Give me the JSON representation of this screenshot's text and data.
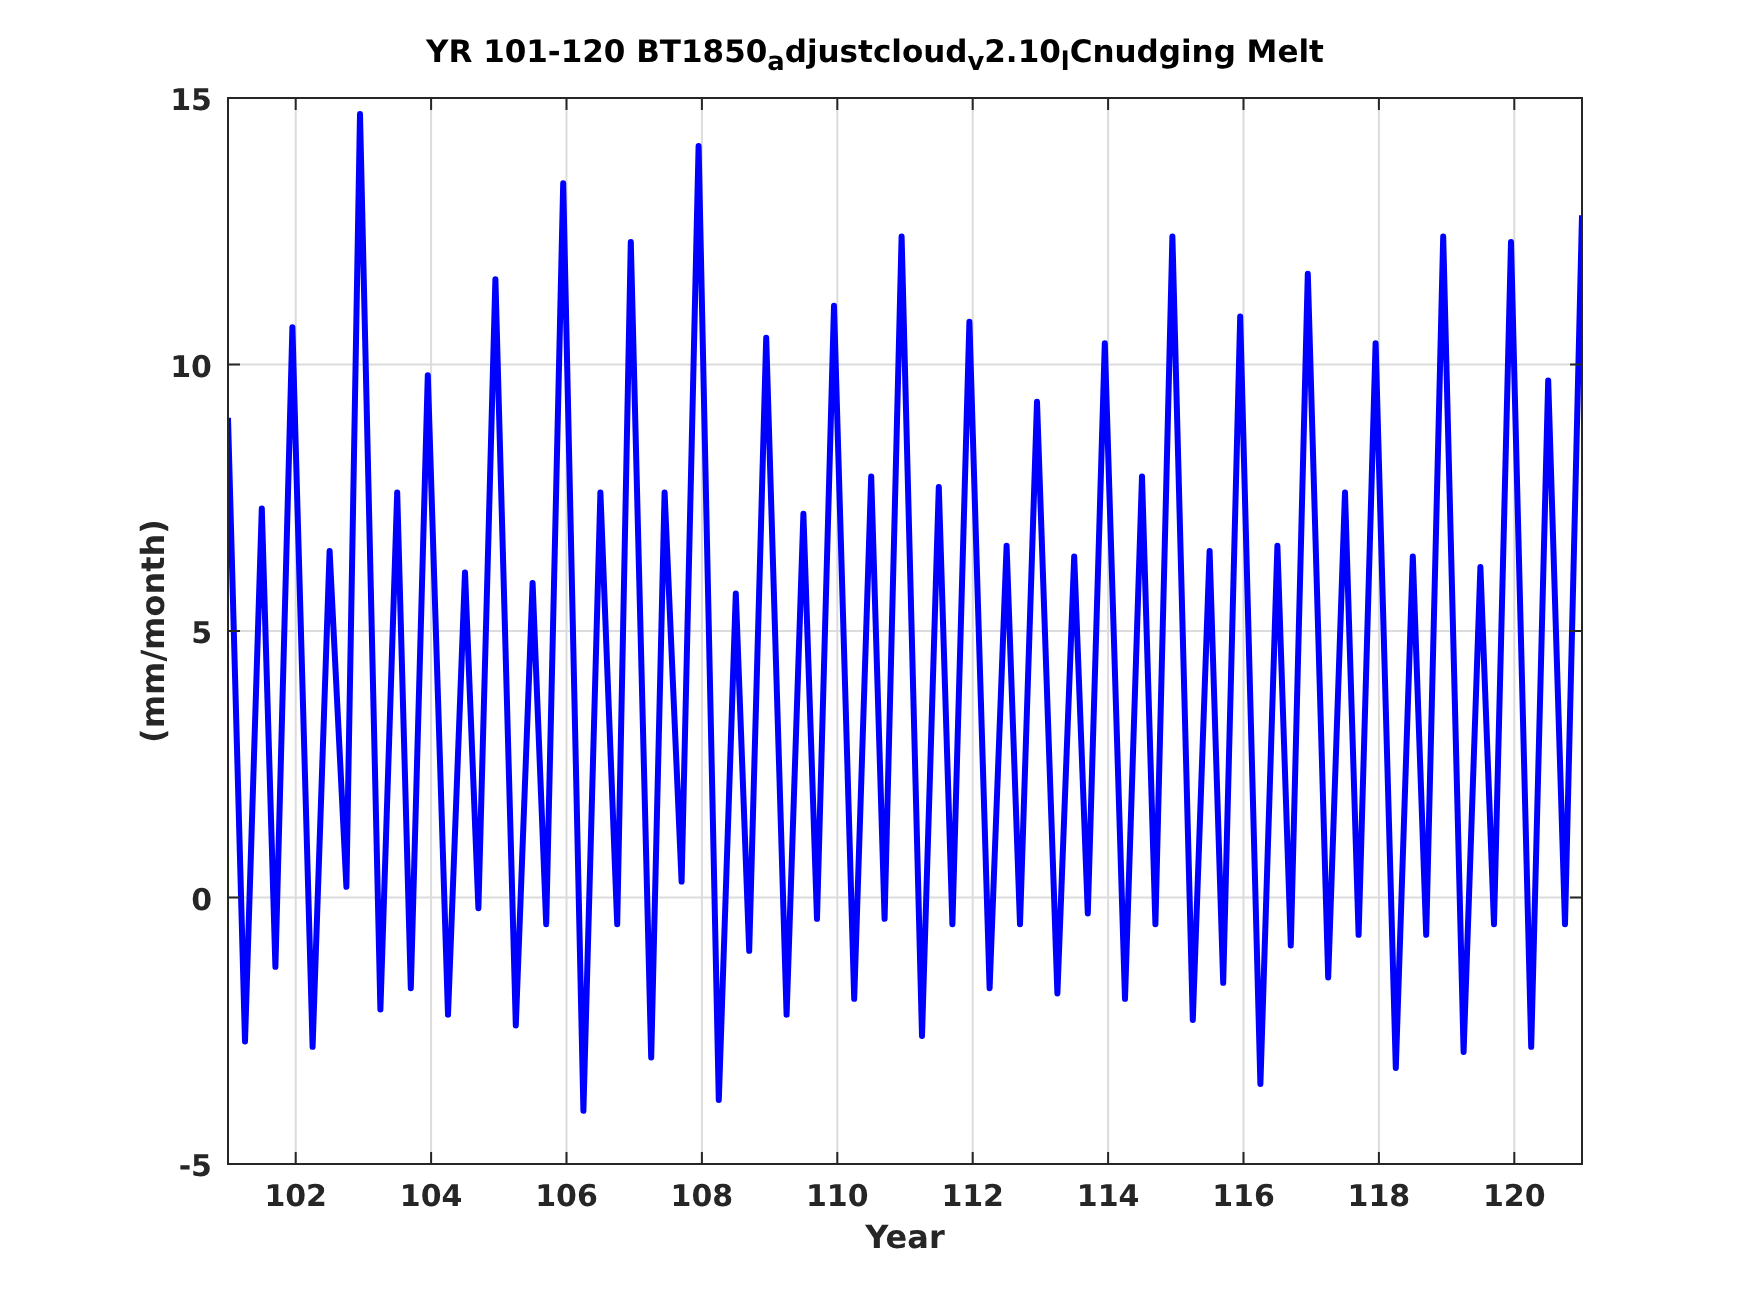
{
  "figure": {
    "chart_data": {
      "type": "line",
      "title": "YR 101-120 BT1850$_{a}$djustcloud$_{v}$2.10$_{l}$Cnudging Melt",
      "xlabel": "Year",
      "ylabel": "(mm/month)",
      "xlim": [
        101,
        121
      ],
      "ylim": [
        -5,
        15
      ],
      "xticks": [
        102,
        104,
        106,
        108,
        110,
        112,
        114,
        116,
        118,
        120
      ],
      "yticks": [
        -5,
        0,
        5,
        10,
        15
      ],
      "x": [
        101,
        101.25,
        101.5,
        101.7,
        101.95,
        102.25,
        102.5,
        102.75,
        102.95,
        103.25,
        103.5,
        103.7,
        103.95,
        104.25,
        104.5,
        104.7,
        104.95,
        105.25,
        105.5,
        105.7,
        105.95,
        106.25,
        106.5,
        106.75,
        106.95,
        107.25,
        107.45,
        107.7,
        107.95,
        108.25,
        108.5,
        108.7,
        108.95,
        109.25,
        109.5,
        109.7,
        109.95,
        110.25,
        110.5,
        110.7,
        110.95,
        111.25,
        111.5,
        111.7,
        111.95,
        112.25,
        112.5,
        112.7,
        112.95,
        113.25,
        113.5,
        113.7,
        113.95,
        114.25,
        114.5,
        114.7,
        114.95,
        115.25,
        115.5,
        115.7,
        115.95,
        116.25,
        116.5,
        116.7,
        116.95,
        117.25,
        117.5,
        117.7,
        117.95,
        118.25,
        118.5,
        118.7,
        118.95,
        119.25,
        119.5,
        119.7,
        119.95,
        120.25,
        120.5,
        120.75,
        121
      ],
      "grid": true,
      "series": [
        {
          "color": "#0000ff",
          "values": [
            9.0,
            -2.7,
            7.3,
            -1.3,
            10.7,
            -2.8,
            6.5,
            0.2,
            14.7,
            -2.1,
            7.6,
            -1.7,
            9.8,
            -2.2,
            6.1,
            -0.2,
            11.6,
            -2.4,
            5.9,
            -0.5,
            13.4,
            -4.0,
            7.6,
            -0.5,
            12.3,
            -3.0,
            7.6,
            0.3,
            14.1,
            -3.8,
            5.7,
            -1.0,
            10.5,
            -2.2,
            7.2,
            -0.4,
            11.1,
            -1.9,
            7.9,
            -0.4,
            12.4,
            -2.6,
            7.7,
            -0.5,
            10.8,
            -1.7,
            6.6,
            -0.5,
            9.3,
            -1.8,
            6.4,
            -0.3,
            10.4,
            -1.9,
            7.9,
            -0.5,
            12.4,
            -2.3,
            6.5,
            -1.6,
            10.9,
            -3.5,
            6.6,
            -0.9,
            11.7,
            -1.5,
            7.6,
            -0.7,
            10.4,
            -3.2,
            6.4,
            -0.7,
            12.4,
            -2.9,
            6.2,
            -0.5,
            12.3,
            -2.8,
            9.7,
            -0.5,
            12.8
          ]
        }
      ]
    }
  }
}
